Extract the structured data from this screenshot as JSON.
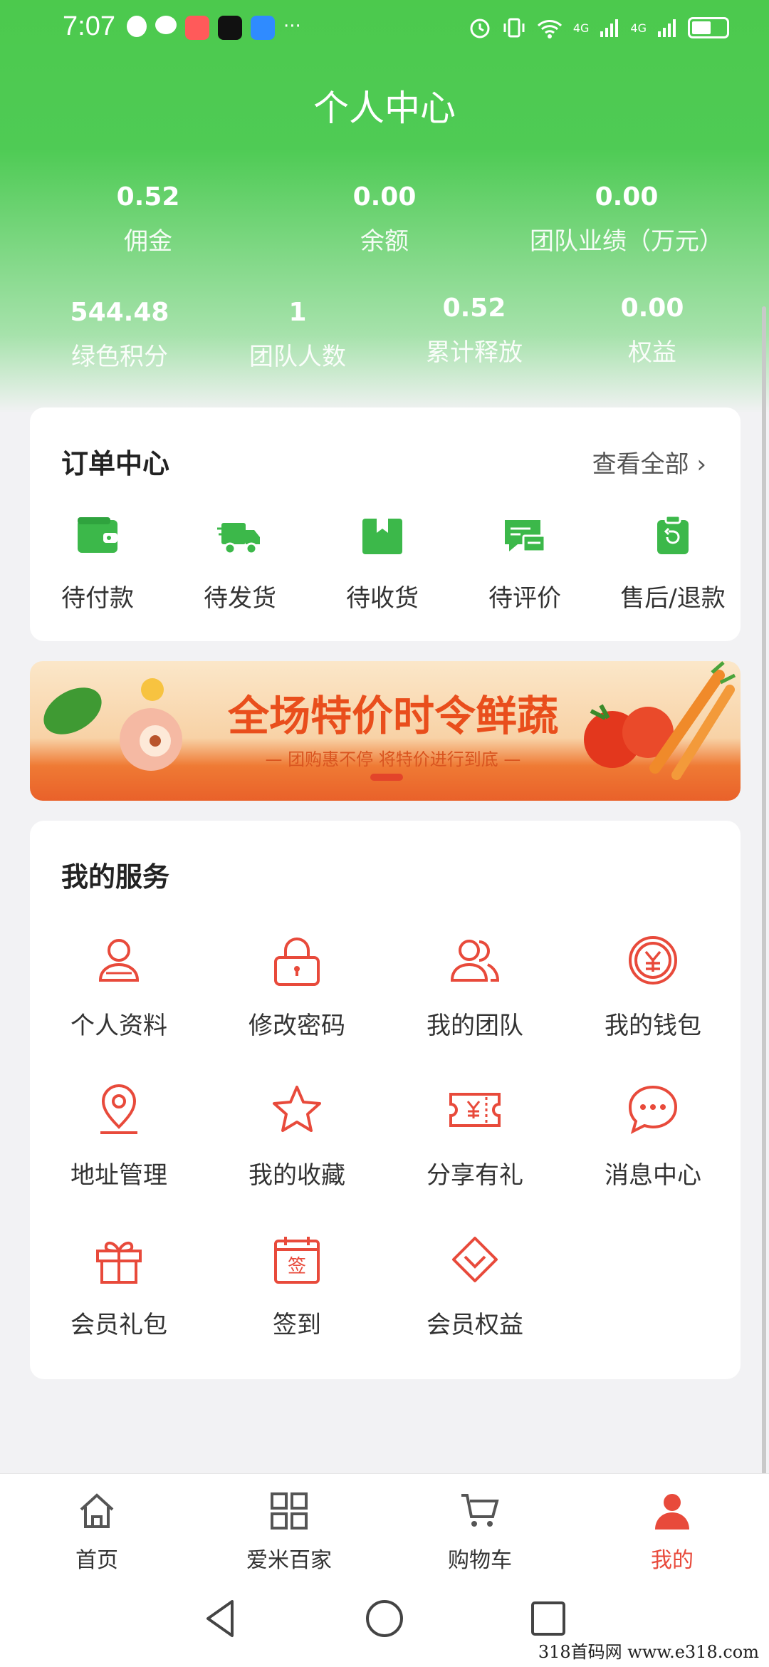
{
  "status_bar": {
    "time": "7:07",
    "more": "···",
    "net1": "4G",
    "net2": "4G"
  },
  "header": {
    "title": "个人中心"
  },
  "stats_row1": [
    {
      "value": "0.52",
      "label": "佣金"
    },
    {
      "value": "0.00",
      "label": "余额"
    },
    {
      "value": "0.00",
      "label": "团队业绩（万元）"
    }
  ],
  "stats_row2": [
    {
      "value": "544.48",
      "label": "绿色积分"
    },
    {
      "value": "1",
      "label": "团队人数"
    },
    {
      "value": "0.52",
      "label": "累计释放"
    },
    {
      "value": "0.00",
      "label": "权益"
    }
  ],
  "orders": {
    "title": "订单中心",
    "view_all": "查看全部 ›",
    "items": [
      {
        "label": "待付款",
        "icon": "wallet-icon"
      },
      {
        "label": "待发货",
        "icon": "truck-icon"
      },
      {
        "label": "待收货",
        "icon": "package-icon"
      },
      {
        "label": "待评价",
        "icon": "review-icon"
      },
      {
        "label": "售后/退款",
        "icon": "refund-icon"
      }
    ]
  },
  "banner": {
    "title": "全场特价时令鲜蔬",
    "subtitle": "— 团购惠不停 将特价进行到底 —"
  },
  "services": {
    "title": "我的服务",
    "items": [
      {
        "label": "个人资料",
        "icon": "user-icon"
      },
      {
        "label": "修改密码",
        "icon": "lock-icon"
      },
      {
        "label": "我的团队",
        "icon": "team-icon"
      },
      {
        "label": "我的钱包",
        "icon": "yen-coin-icon"
      },
      {
        "label": "地址管理",
        "icon": "location-icon"
      },
      {
        "label": "我的收藏",
        "icon": "star-icon"
      },
      {
        "label": "分享有礼",
        "icon": "coupon-icon"
      },
      {
        "label": "消息中心",
        "icon": "message-icon"
      },
      {
        "label": "会员礼包",
        "icon": "gift-icon"
      },
      {
        "label": "签到",
        "icon": "checkin-calendar-icon"
      },
      {
        "label": "会员权益",
        "icon": "diamond-icon"
      }
    ]
  },
  "tabbar": {
    "items": [
      {
        "label": "首页",
        "icon": "home-icon"
      },
      {
        "label": "爱米百家",
        "icon": "grid-icon"
      },
      {
        "label": "购物车",
        "icon": "cart-icon"
      },
      {
        "label": "我的",
        "icon": "profile-icon",
        "active": true
      }
    ]
  },
  "colors": {
    "brand_green": "#4cc94d",
    "accent_red": "#e84a3b",
    "icon_green": "#3cb84a"
  },
  "watermark": "318首码网  www.e318.com"
}
